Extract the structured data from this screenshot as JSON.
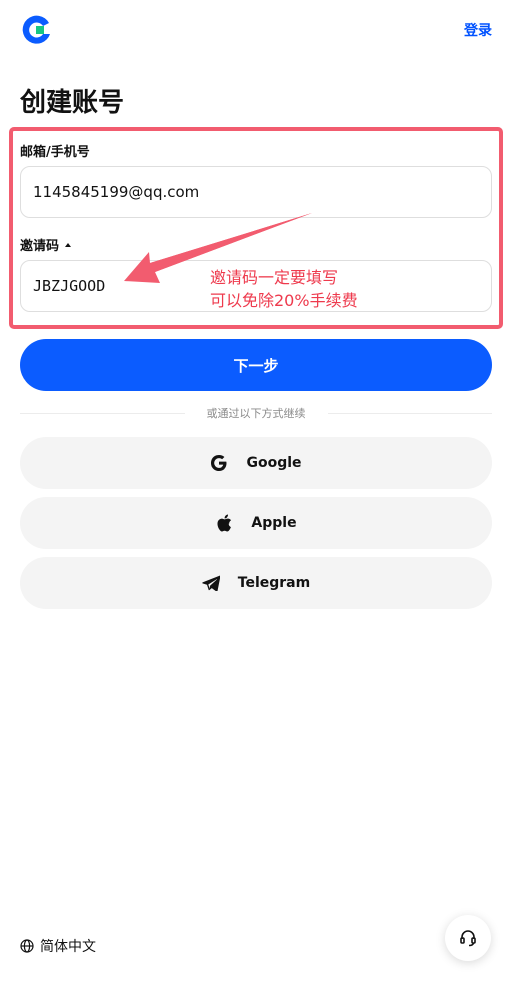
{
  "header": {
    "login_label": "登录"
  },
  "page": {
    "title": "创建账号"
  },
  "form": {
    "email_label": "邮箱/手机号",
    "email_value": "1145845199@qq.com",
    "invite_label": "邀请码",
    "invite_value": "JBZJGOOD",
    "next_label": "下一步"
  },
  "annotation": {
    "line1": "邀请码一定要填写",
    "line2": "可以免除20%手续费",
    "color": "#ee3a4d"
  },
  "divider": {
    "text": "或通过以下方式继续"
  },
  "social": [
    {
      "label": "Google",
      "icon": "google-icon"
    },
    {
      "label": "Apple",
      "icon": "apple-icon"
    },
    {
      "label": "Telegram",
      "icon": "telegram-icon"
    }
  ],
  "footer": {
    "language": "简体中文"
  },
  "colors": {
    "accent": "#0b5cff",
    "brand_green": "#16c784",
    "annotation_red": "#f25c6f"
  }
}
